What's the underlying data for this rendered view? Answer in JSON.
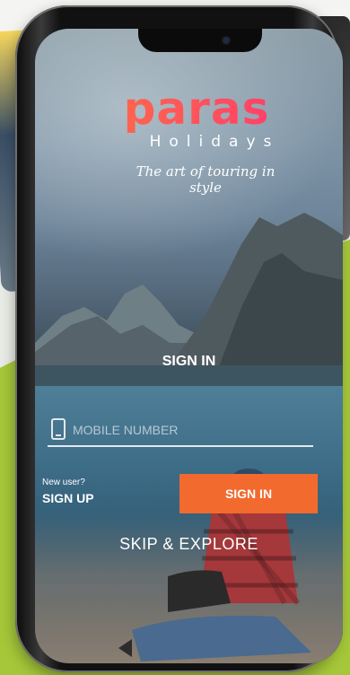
{
  "brand": {
    "name": "paras",
    "sub": "Holidays",
    "tagline": "The art of touring in style",
    "accent": "#ff4b5c"
  },
  "screen": {
    "section_title": "SIGN IN",
    "mobile": {
      "placeholder": "MOBILE NUMBER",
      "value": "",
      "icon": "smartphone-icon"
    },
    "new_user_label": "New user?",
    "signup_label": "SIGN UP",
    "signin_button_label": "SIGN IN",
    "signin_button_color": "#f26a2e",
    "skip_label": "SKIP & EXPLORE"
  }
}
